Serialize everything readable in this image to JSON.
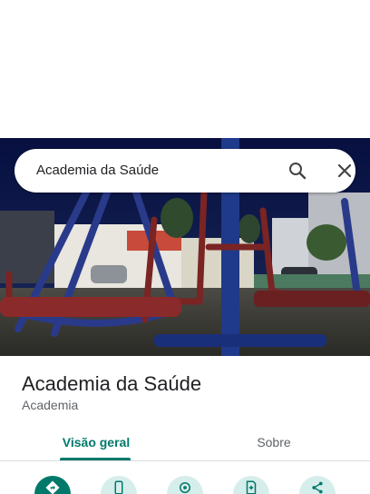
{
  "search": {
    "query": "Academia da Saúde",
    "search_icon": "search-icon",
    "close_icon": "close-icon"
  },
  "place": {
    "name": "Academia da Saúde",
    "category": "Academia"
  },
  "tabs": [
    {
      "label": "Visão geral",
      "selected": true
    },
    {
      "label": "Sobre",
      "selected": false
    }
  ],
  "actions": [
    {
      "icon": "directions-icon"
    },
    {
      "icon": "phone-icon"
    },
    {
      "icon": "location-icon"
    },
    {
      "icon": "save-icon"
    },
    {
      "icon": "share-icon"
    }
  ],
  "colors": {
    "accent": "#00796b",
    "accent_light": "#d6eeeb",
    "text_primary": "#202124",
    "text_secondary": "#5f6368"
  }
}
